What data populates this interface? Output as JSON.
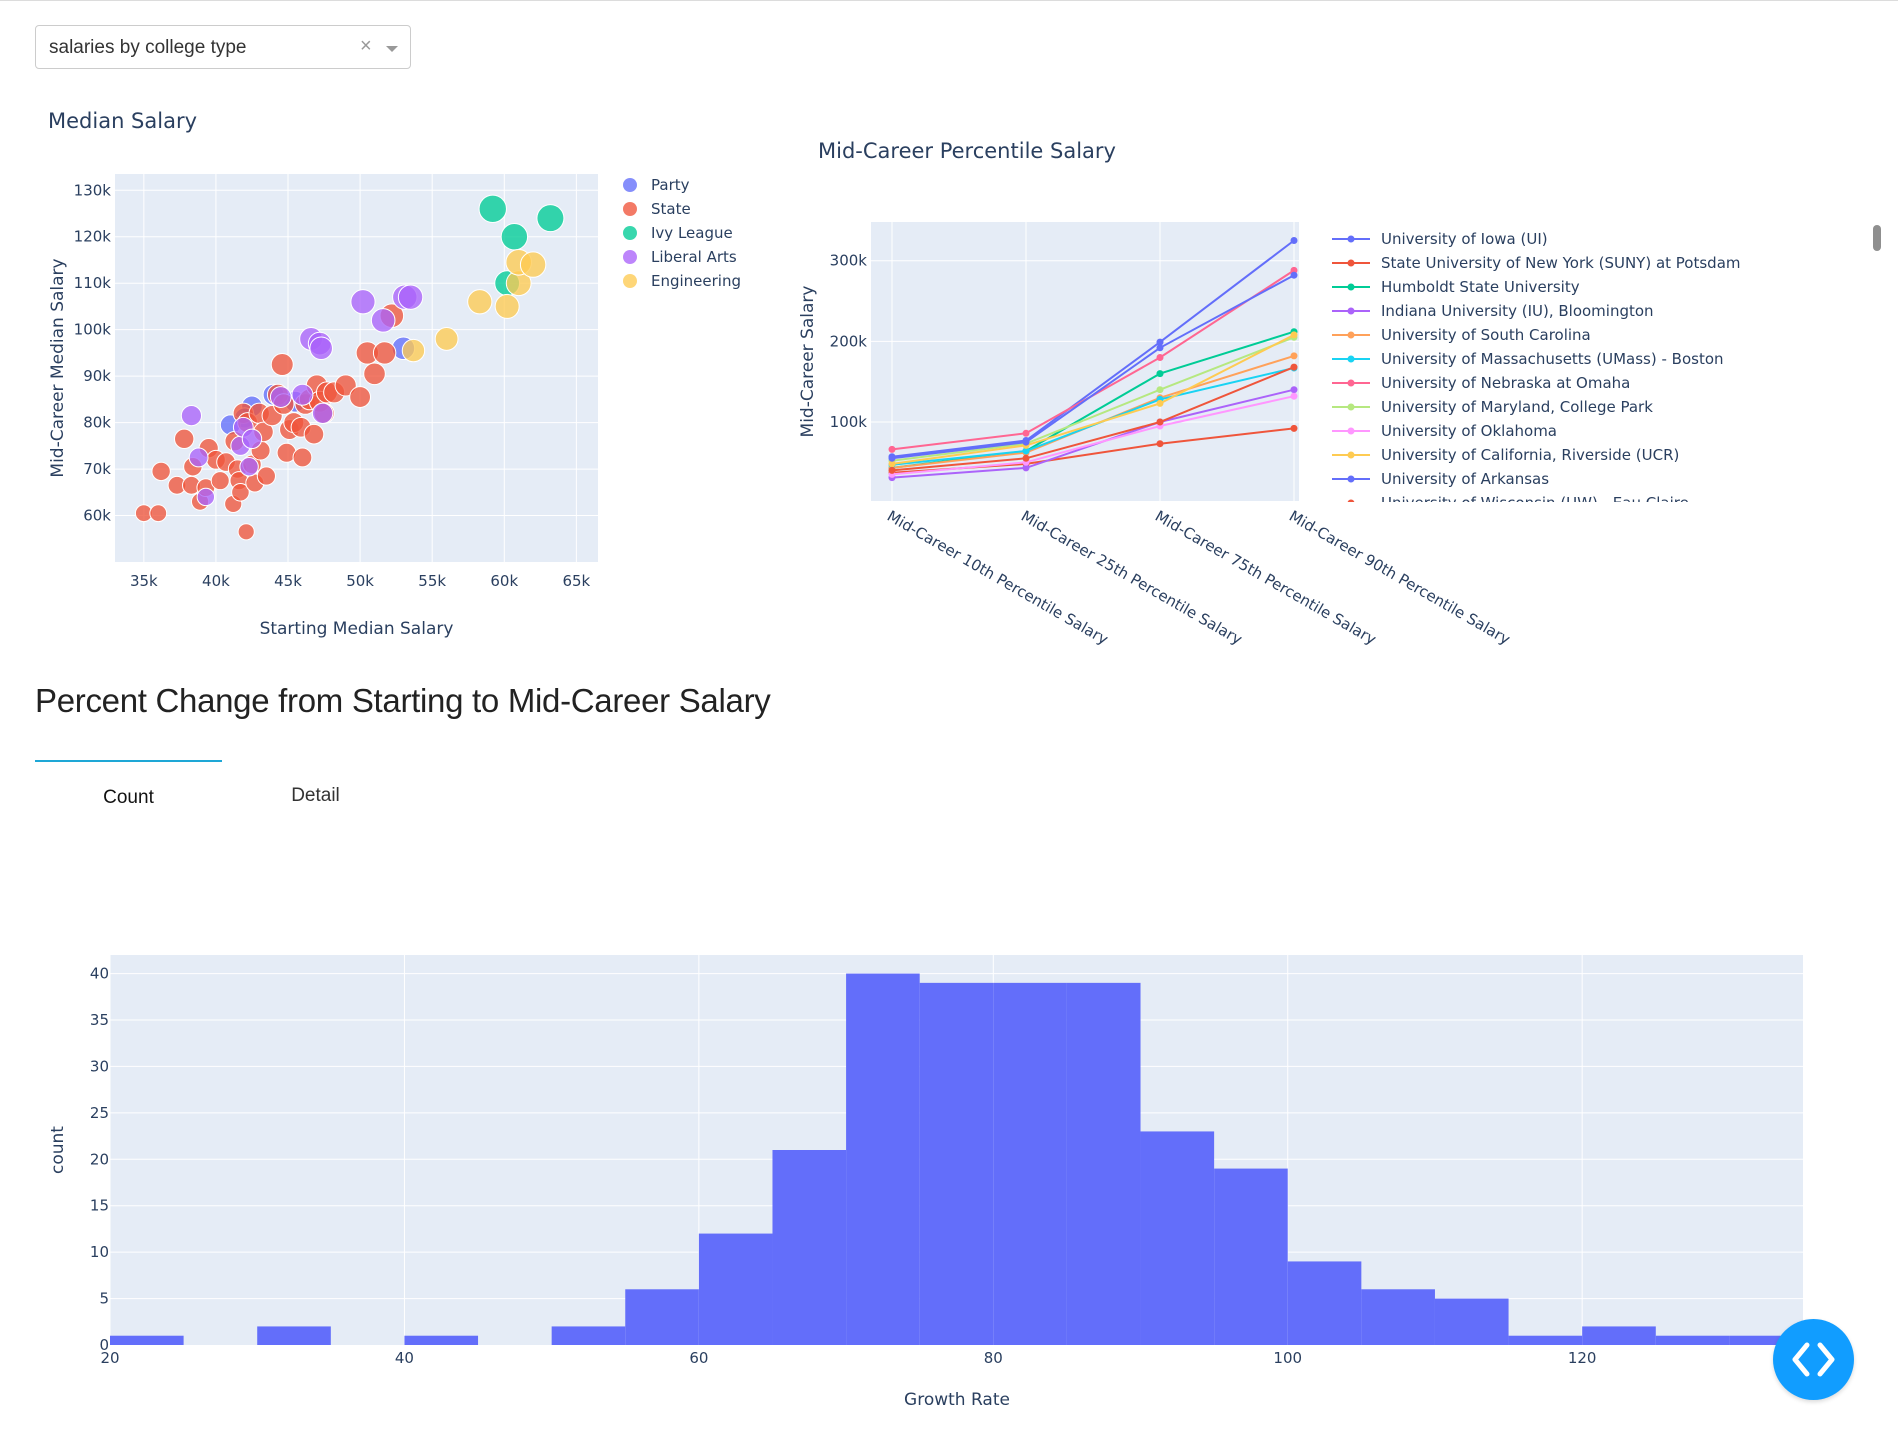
{
  "dropdown": {
    "value": "salaries by college type",
    "clear_glyph": "×"
  },
  "section": {
    "title": "Percent Change from Starting to Mid-Career Salary"
  },
  "tabs": [
    {
      "label": "Count",
      "active": true
    },
    {
      "label": "Detail",
      "active": false
    }
  ],
  "icons": {
    "fab": "code-brackets-icon",
    "clear": "close-icon",
    "caret": "chevron-down-icon"
  },
  "colors": {
    "plot_bg": "#e5ecf6",
    "bar": "#636efa",
    "fab": "#119dff",
    "tab_indicator": "#1ea7d6"
  },
  "chart_data": [
    {
      "id": "scatter",
      "type": "scatter",
      "title": "Median Salary",
      "xlabel": "Starting Median Salary",
      "ylabel": "Mid-Career Median Salary",
      "xlim": [
        33000,
        66500
      ],
      "ylim": [
        50000,
        133500
      ],
      "xticks": [
        35000,
        40000,
        45000,
        50000,
        55000,
        60000,
        65000
      ],
      "xtick_labels": [
        "35k",
        "40k",
        "45k",
        "50k",
        "55k",
        "60k",
        "65k"
      ],
      "yticks": [
        60000,
        70000,
        80000,
        90000,
        100000,
        110000,
        120000,
        130000
      ],
      "ytick_labels": [
        "60k",
        "70k",
        "80k",
        "90k",
        "100k",
        "110k",
        "120k",
        "130k"
      ],
      "legend_position": "right",
      "series": [
        {
          "name": "Party",
          "color": "#636efa",
          "points": [
            [
              42500,
              83500
            ],
            [
              53000,
              96000
            ],
            [
              42000,
              81000
            ],
            [
              45500,
              84500
            ],
            [
              41000,
              79500
            ],
            [
              44000,
              86000
            ]
          ]
        },
        {
          "name": "State",
          "color": "#ef553b",
          "points": [
            [
              35000,
              60500
            ],
            [
              36000,
              60500
            ],
            [
              36200,
              69500
            ],
            [
              37300,
              66500
            ],
            [
              37800,
              76500
            ],
            [
              38300,
              66500
            ],
            [
              38400,
              70500
            ],
            [
              38900,
              63000
            ],
            [
              39300,
              66000
            ],
            [
              39500,
              74500
            ],
            [
              40000,
              72000
            ],
            [
              40300,
              67500
            ],
            [
              40700,
              71500
            ],
            [
              41200,
              62500
            ],
            [
              41300,
              76000
            ],
            [
              41500,
              70000
            ],
            [
              41600,
              67500
            ],
            [
              41700,
              65000
            ],
            [
              41900,
              82000
            ],
            [
              42100,
              56500
            ],
            [
              42200,
              80000
            ],
            [
              42500,
              71000
            ],
            [
              42700,
              67000
            ],
            [
              43000,
              82000
            ],
            [
              43100,
              74000
            ],
            [
              43300,
              78000
            ],
            [
              43500,
              68500
            ],
            [
              43900,
              81500
            ],
            [
              44300,
              86000
            ],
            [
              44600,
              92500
            ],
            [
              44700,
              84000
            ],
            [
              44900,
              73500
            ],
            [
              45100,
              78500
            ],
            [
              45400,
              80000
            ],
            [
              45900,
              79000
            ],
            [
              46000,
              72500
            ],
            [
              46200,
              84000
            ],
            [
              46500,
              85000
            ],
            [
              46800,
              77500
            ],
            [
              47000,
              88000
            ],
            [
              47200,
              84500
            ],
            [
              47500,
              82000
            ],
            [
              47700,
              86500
            ],
            [
              48200,
              86500
            ],
            [
              49000,
              88000
            ],
            [
              50000,
              85500
            ],
            [
              50500,
              95000
            ],
            [
              51000,
              90500
            ],
            [
              51700,
              95000
            ],
            [
              52200,
              103000
            ]
          ]
        },
        {
          "name": "Ivy League",
          "color": "#00cc96",
          "points": [
            [
              59200,
              126000
            ],
            [
              63200,
              124000
            ],
            [
              60700,
              120000
            ],
            [
              60200,
              110000
            ]
          ]
        },
        {
          "name": "Liberal Arts",
          "color": "#ab63fa",
          "points": [
            [
              38300,
              81500
            ],
            [
              38800,
              72500
            ],
            [
              39300,
              64000
            ],
            [
              41700,
              75000
            ],
            [
              41900,
              79000
            ],
            [
              42300,
              70500
            ],
            [
              42500,
              76500
            ],
            [
              44500,
              85500
            ],
            [
              46000,
              86000
            ],
            [
              46600,
              98000
            ],
            [
              47200,
              97000
            ],
            [
              47300,
              96000
            ],
            [
              47400,
              82000
            ],
            [
              50200,
              106000
            ],
            [
              51600,
              102000
            ],
            [
              53100,
              107000
            ],
            [
              53500,
              107000
            ]
          ]
        },
        {
          "name": "Engineering",
          "color": "#fecb52",
          "points": [
            [
              53700,
              95500
            ],
            [
              56000,
              98000
            ],
            [
              58300,
              106000
            ],
            [
              60200,
              105000
            ],
            [
              61000,
              110000
            ],
            [
              61000,
              114500
            ],
            [
              62000,
              114000
            ]
          ]
        }
      ]
    },
    {
      "id": "percentile",
      "type": "line",
      "title": "Mid-Career Percentile Salary",
      "xlabel": "",
      "ylabel": "Mid-Career Salary",
      "categories": [
        "Mid-Career 10th Percentile Salary",
        "Mid-Career 25th Percentile Salary",
        "Mid-Career 75th Percentile Salary",
        "Mid-Career 90th Percentile Salary"
      ],
      "ylim": [
        2000,
        348000
      ],
      "yticks": [
        100000,
        200000,
        300000
      ],
      "ytick_labels": [
        "100k",
        "200k",
        "300k"
      ],
      "legend_position": "right",
      "series": [
        {
          "name": "University of Iowa (UI)",
          "color": "#636efa",
          "values": [
            57000,
            77000,
            199000,
            325000
          ]
        },
        {
          "name": "State University of New York (SUNY) at Potsdam",
          "color": "#ef553b",
          "values": [
            37000,
            48000,
            73000,
            92000
          ]
        },
        {
          "name": "Humboldt State University",
          "color": "#00cc96",
          "values": [
            43000,
            64000,
            160000,
            212000
          ]
        },
        {
          "name": "Indiana University (IU), Bloomington",
          "color": "#ab63fa",
          "values": [
            31000,
            43000,
            100000,
            140000
          ]
        },
        {
          "name": "University of South Carolina",
          "color": "#ffa15a",
          "values": [
            43000,
            62000,
            130000,
            182000
          ]
        },
        {
          "name": "University of Massachusetts (UMass) - Boston",
          "color": "#19d3f3",
          "values": [
            47000,
            64000,
            128000,
            167000
          ]
        },
        {
          "name": "University of Nebraska at Omaha",
          "color": "#ff6692",
          "values": [
            66000,
            86000,
            180000,
            288000
          ]
        },
        {
          "name": "University of Maryland, College Park",
          "color": "#b6e880",
          "values": [
            52000,
            73000,
            140000,
            205000
          ]
        },
        {
          "name": "University of Oklahoma",
          "color": "#ff97ff",
          "values": [
            35000,
            50000,
            95000,
            132000
          ]
        },
        {
          "name": "University of California, Riverside (UCR)",
          "color": "#fecb52",
          "values": [
            48000,
            71000,
            123000,
            208000
          ]
        },
        {
          "name": "University of Arkansas",
          "color": "#636efa",
          "values": [
            55000,
            75000,
            192000,
            282000
          ]
        },
        {
          "name": "University of Wisconsin (UW) - Eau Claire",
          "color": "#ef553b",
          "values": [
            40000,
            55000,
            100000,
            168000
          ]
        }
      ]
    },
    {
      "id": "growth",
      "type": "bar",
      "title": "",
      "xlabel": "Growth Rate",
      "ylabel": "count",
      "bin_width": 5,
      "bin_starts": [
        20,
        25,
        30,
        35,
        40,
        45,
        50,
        55,
        60,
        65,
        70,
        75,
        80,
        85,
        90,
        95,
        100,
        105,
        110,
        115,
        120,
        125,
        130
      ],
      "values": [
        1,
        0,
        2,
        0,
        1,
        0,
        2,
        6,
        12,
        21,
        40,
        39,
        39,
        39,
        23,
        19,
        9,
        6,
        5,
        1,
        2,
        1,
        1
      ],
      "xlim": [
        20,
        135
      ],
      "ylim": [
        0,
        42
      ],
      "xticks": [
        20,
        40,
        60,
        80,
        100,
        120
      ],
      "yticks": [
        0,
        5,
        10,
        15,
        20,
        25,
        30,
        35,
        40
      ]
    }
  ]
}
